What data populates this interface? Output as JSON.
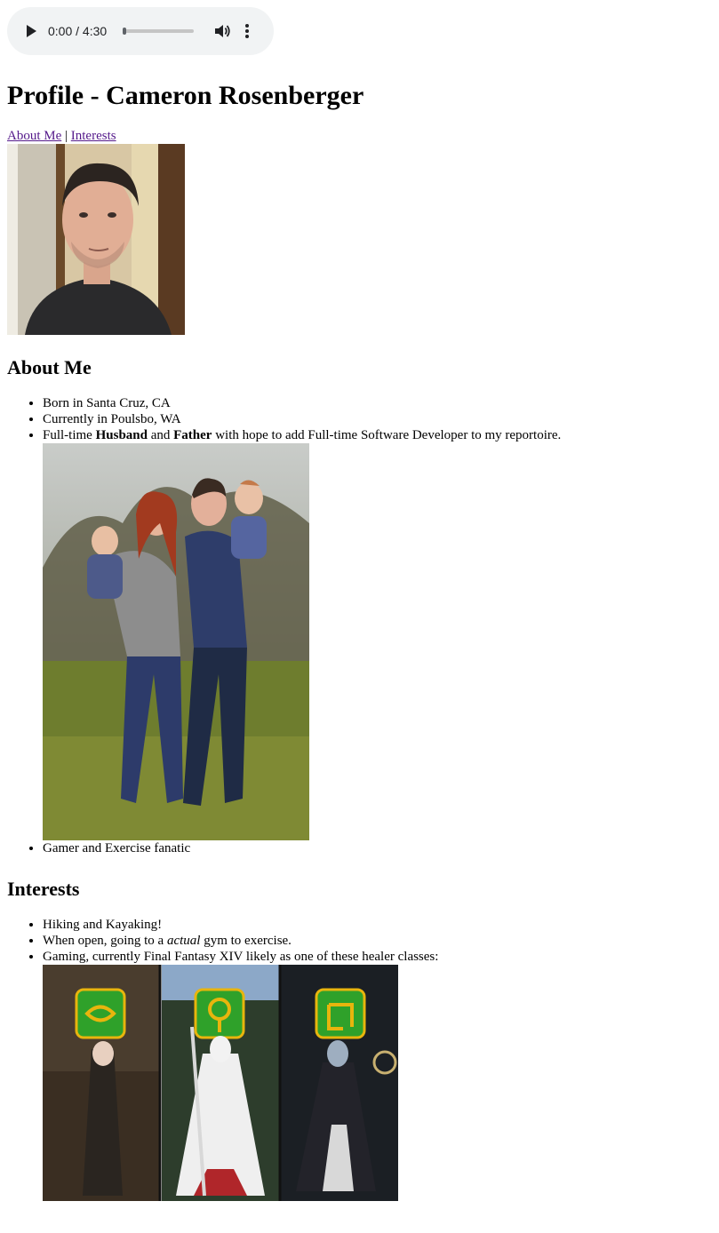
{
  "audio": {
    "current_time": "0:00",
    "duration": "4:30",
    "separator": " / ",
    "progress": 0.0
  },
  "page_title": "Profile - Cameron Rosenberger",
  "nav": {
    "about_label": "About Me",
    "separator": "|",
    "interests_label": "Interests"
  },
  "about": {
    "heading": "About Me",
    "items": [
      "Born in Santa Cruz, CA",
      "Currently in Poulsbo, WA"
    ],
    "item3": {
      "prefix": "Full-time ",
      "bold1": "Husband",
      "mid": " and ",
      "bold2": "Father",
      "suffix": " with hope to add Full-time Software Developer to my reportoire."
    },
    "item4": "Gamer and Exercise fanatic"
  },
  "interests": {
    "heading": "Interests",
    "item1": "Hiking and Kayaking!",
    "item2": {
      "prefix": "When open, going to a ",
      "em": "actual",
      "suffix": " gym to exercise."
    },
    "item3": "Gaming, currently Final Fantasy XIV likely as one of these healer classes:"
  },
  "colors": {
    "link_visited": "#551a8b",
    "player_bg": "#f1f3f4",
    "healer_icon_green": "#2fa12a",
    "healer_icon_gold": "#e8b50d"
  }
}
